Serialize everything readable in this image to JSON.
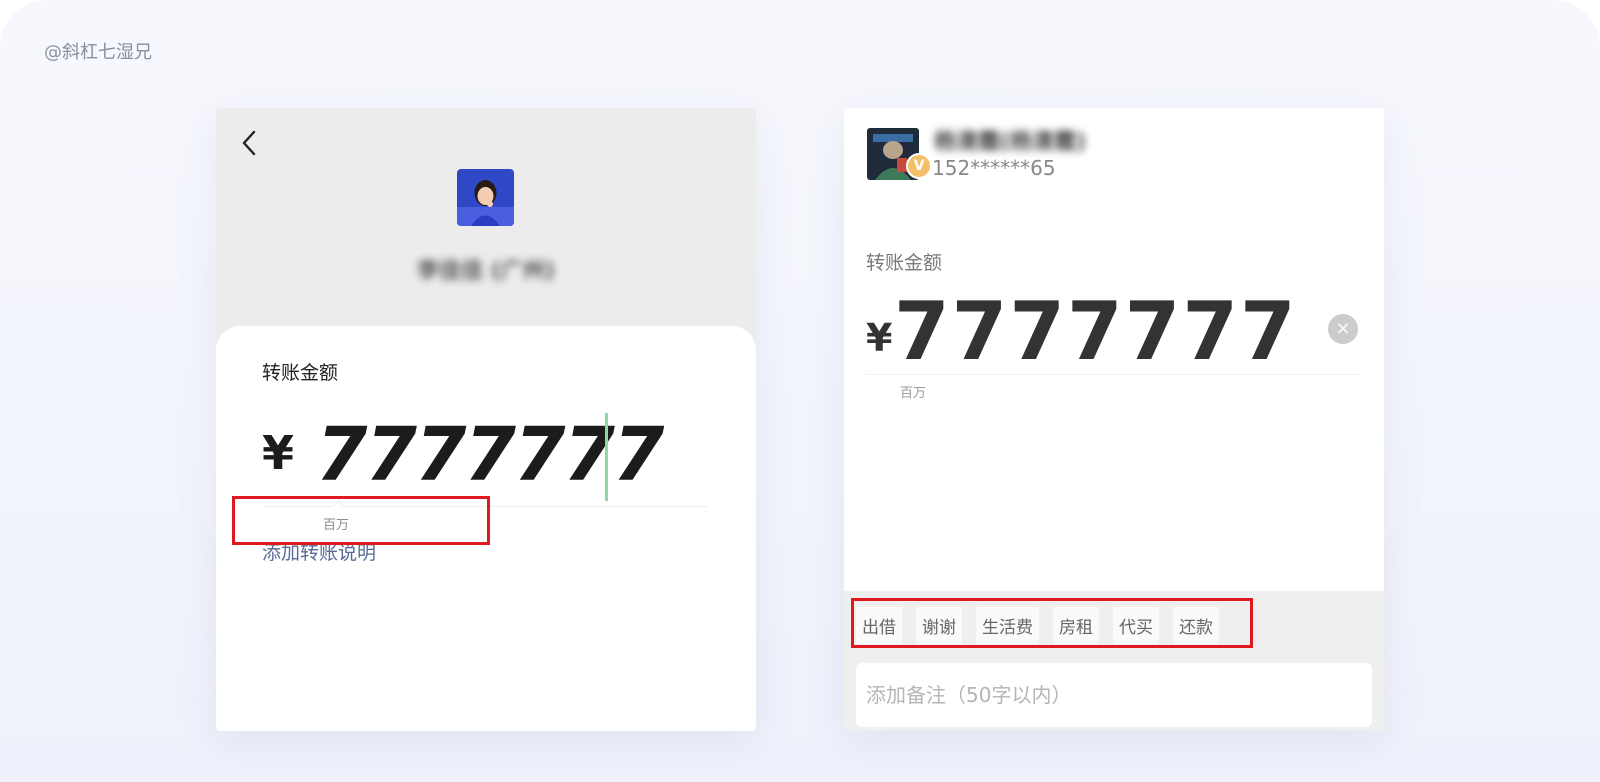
{
  "watermark": "@斜杠七湿兄",
  "left": {
    "name": "李佳佳 (广州)",
    "amount_label": "转账金额",
    "currency": "¥",
    "amount": "7777777",
    "unit_hint": "百万",
    "add_note_link": "添加转账说明"
  },
  "right": {
    "name": "杨清霞(杨清霞)",
    "phone": "152******65",
    "badge": "V",
    "amount_label": "转账金额",
    "currency": "¥",
    "amount": "7777777",
    "unit_hint": "百万",
    "clear_symbol": "×",
    "chips": [
      "出借",
      "谢谢",
      "生活费",
      "房租",
      "代买",
      "还款"
    ],
    "remark_placeholder": "添加备注（50字以内）"
  },
  "colors": {
    "highlight": "#e0191f",
    "wechat_link": "#576b95",
    "caret": "#8fd8a5"
  }
}
